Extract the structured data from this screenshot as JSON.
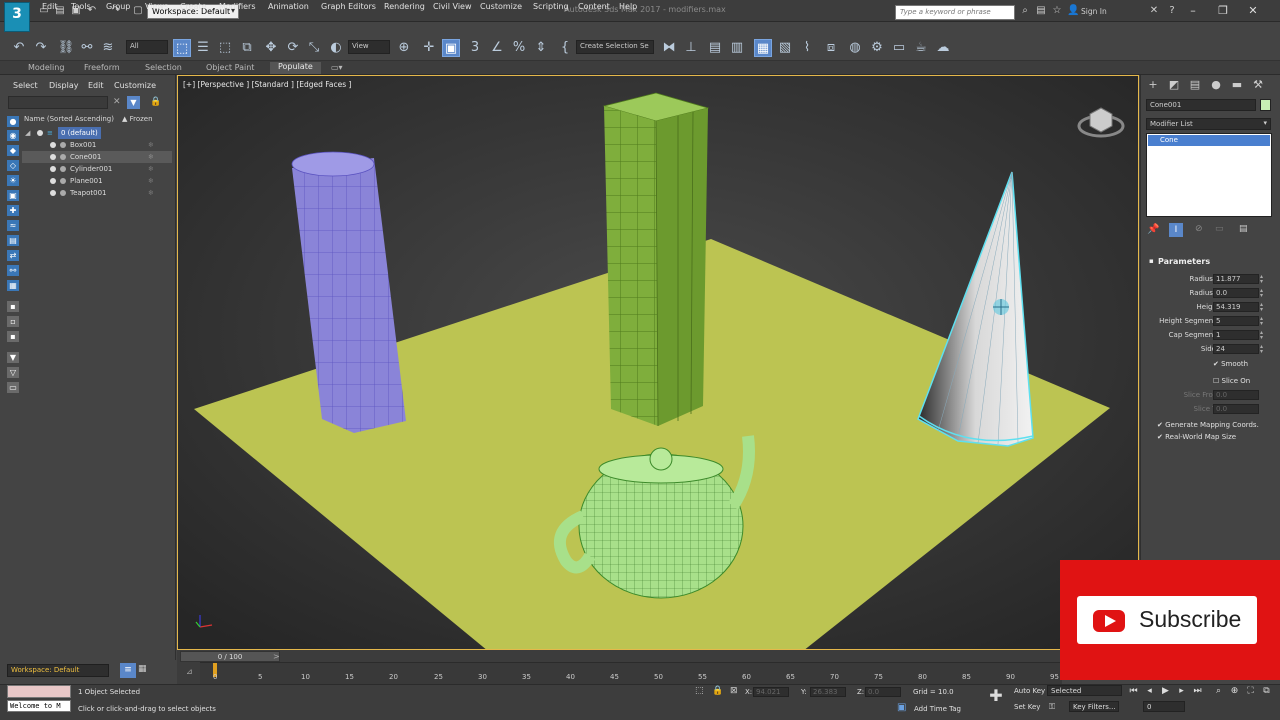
{
  "window": {
    "title": "Autodesk 3ds Max 2017 - modifiers.max",
    "workspace": "Workspace: Default",
    "search_placeholder": "Type a keyword or phrase",
    "sign_in": "Sign In",
    "logo": "3"
  },
  "menu": [
    "Edit",
    "Tools",
    "Group",
    "Views",
    "Create",
    "Modifiers",
    "Animation",
    "Graph Editors",
    "Rendering",
    "Civil View",
    "Customize",
    "Scripting",
    "Content",
    "Help"
  ],
  "toolbar": {
    "filter": "All",
    "ref_coord": "View",
    "selection_set": "Create Selection Se"
  },
  "ribbon": {
    "tabs": [
      "Modeling",
      "Freeform",
      "Selection",
      "Object Paint",
      "Populate"
    ]
  },
  "explorer": {
    "tabs": [
      "Select",
      "Display",
      "Edit",
      "Customize"
    ],
    "col_name": "Name (Sorted Ascending)",
    "col_frozen": "▲ Frozen",
    "items": [
      "0 (default)",
      "Box001",
      "Cone001",
      "Cylinder001",
      "Plane001",
      "Teapot001"
    ],
    "selected_index": 2
  },
  "viewport": {
    "label": "[+] [Perspective ] [Standard ] [Edged Faces ]"
  },
  "command_panel": {
    "object_name": "Cone001",
    "modifier_list": "Modifier List",
    "stack_item": "Cone",
    "params_title": "Parameters",
    "params": [
      {
        "label": "Radius 1:",
        "value": "11.877",
        "dim": false
      },
      {
        "label": "Radius 2:",
        "value": "0.0",
        "dim": false
      },
      {
        "label": "Height:",
        "value": "54.319",
        "dim": false
      },
      {
        "label": "Height Segments:",
        "value": "5",
        "dim": false
      },
      {
        "label": "Cap Segments:",
        "value": "1",
        "dim": false
      },
      {
        "label": "Sides:",
        "value": "24",
        "dim": false
      }
    ],
    "smooth": "Smooth",
    "slice_on": "Slice On",
    "slice_from_label": "Slice From:",
    "slice_from": "0.0",
    "slice_to_label": "Slice To:",
    "slice_to": "0.0",
    "gen_mapping": "Generate Mapping Coords.",
    "real_world": "Real-World Map Size"
  },
  "timeline": {
    "slider": "0 / 100",
    "ticks": [
      "0",
      "5",
      "10",
      "15",
      "20",
      "25",
      "30",
      "35",
      "40",
      "45",
      "50",
      "55",
      "60",
      "65",
      "70",
      "75",
      "80",
      "85",
      "90",
      "95"
    ]
  },
  "status": {
    "workspace": "Workspace: Default",
    "maxscript_listener": "Welcome to M",
    "selection": "1 Object Selected",
    "prompt": "Click or click-and-drag to select objects",
    "x_label": "X:",
    "x_value": "94.021",
    "y_label": "Y:",
    "y_value": "26.383",
    "z_label": "Z:",
    "z_value": "0.0",
    "grid": "Grid = 10.0",
    "add_time_tag": "Add Time Tag",
    "auto_key": "Auto Key",
    "set_key": "Set Key",
    "key_mode": "Selected",
    "key_filters": "Key Filters...",
    "frame": "0"
  },
  "overlay": {
    "subscribe": "Subscribe"
  },
  "colors": {
    "viewport_border": "#e5b84b",
    "selection_blue": "#4a7fcf",
    "plane": "#bcc452",
    "box": "#7fae3c",
    "cylinder": "#8a84d8",
    "teapot": "#a8e08a",
    "subscribe_red": "#e01313"
  }
}
